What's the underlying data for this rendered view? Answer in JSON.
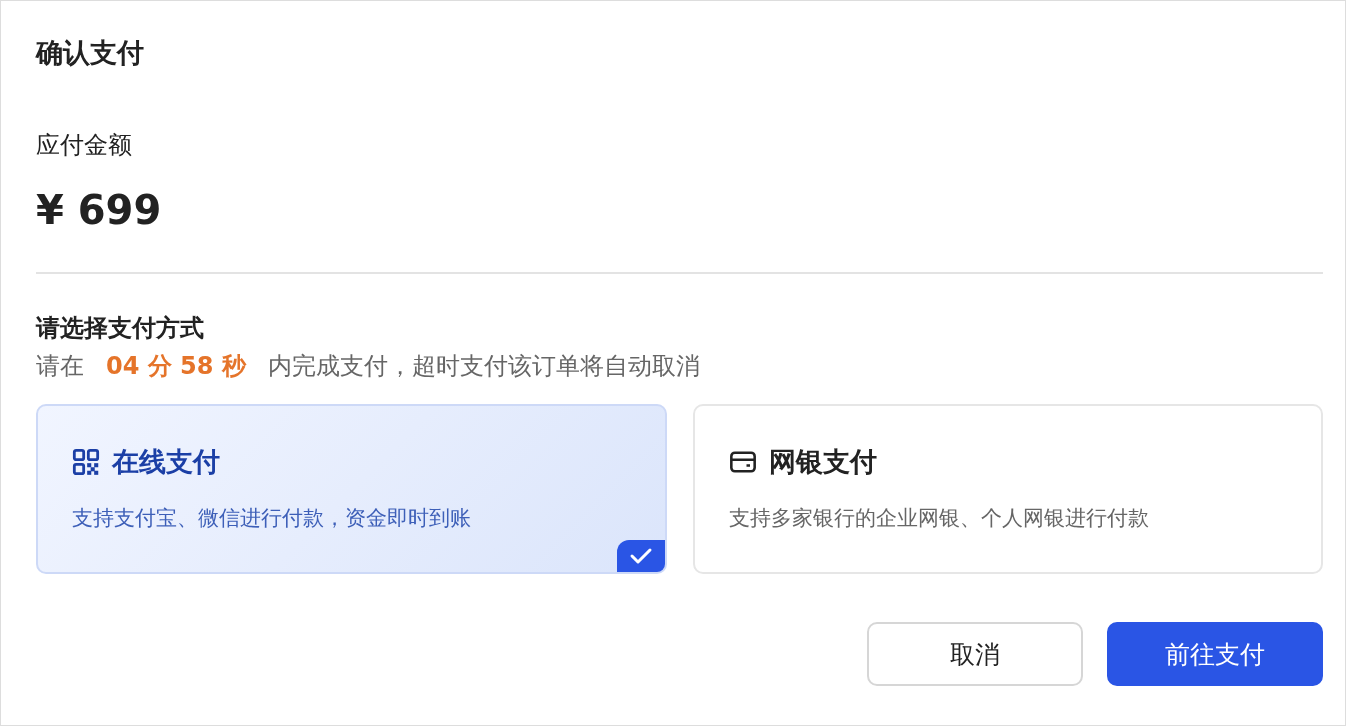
{
  "dialog": {
    "title": "确认支付"
  },
  "amount": {
    "label": "应付金额",
    "value": "¥ 699"
  },
  "method": {
    "heading": "请选择支付方式",
    "notice_before": "请在",
    "countdown": "04 分 58 秒",
    "notice_after": "内完成支付，超时支付该订单将自动取消"
  },
  "options": [
    {
      "kind": "qr",
      "title": "在线支付",
      "description": "支持支付宝、微信进行付款，资金即时到账",
      "selected": true
    },
    {
      "kind": "card",
      "title": "网银支付",
      "description": "支持多家银行的企业网银、个人网银进行付款",
      "selected": false
    }
  ],
  "buttons": [
    {
      "label": "取消",
      "kind": "secondary"
    },
    {
      "label": "前往支付",
      "kind": "primary"
    }
  ]
}
